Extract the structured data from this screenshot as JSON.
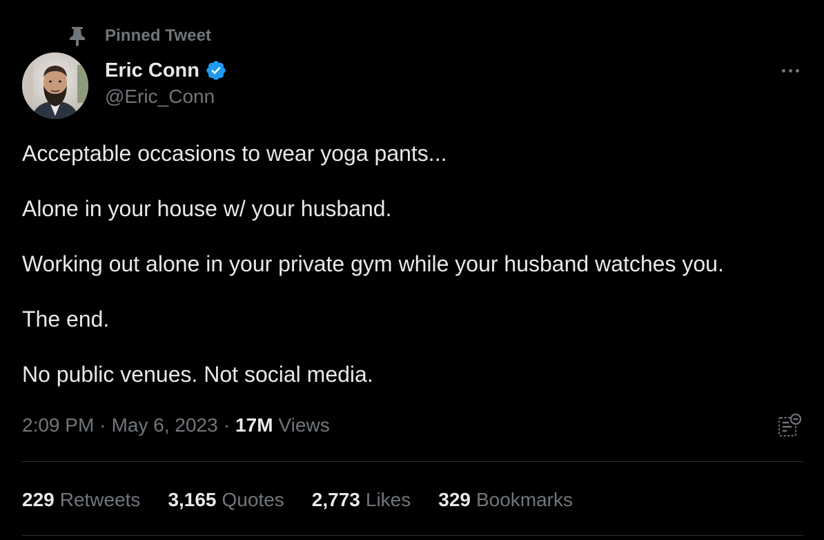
{
  "pinned": {
    "icon": "pin-icon",
    "label": "Pinned Tweet"
  },
  "author": {
    "avatar": "avatar",
    "name": "Eric Conn",
    "verified_icon": "verified-badge-icon",
    "verified_color": "#1d9bf0",
    "handle": "@Eric_Conn"
  },
  "more_icon": "more-options-icon",
  "tweet": {
    "lines": [
      "Acceptable occasions to wear yoga pants...",
      "Alone in your house w/ your husband.",
      "Working out alone in your private gym while your husband watches you.",
      "The end.",
      "No public venues. Not social media."
    ]
  },
  "meta": {
    "time": "2:09 PM",
    "separator": "·",
    "date": "May 6, 2023",
    "views_count": "17M",
    "views_label": "Views",
    "analytics_icon": "analytics-icon"
  },
  "stats": [
    {
      "count": "229",
      "label": "Retweets"
    },
    {
      "count": "3,165",
      "label": "Quotes"
    },
    {
      "count": "2,773",
      "label": "Likes"
    },
    {
      "count": "329",
      "label": "Bookmarks"
    }
  ],
  "colors": {
    "background": "#000000",
    "primary_text": "#e7e9ea",
    "secondary_text": "#71767b",
    "divider": "#2f3336",
    "accent": "#1d9bf0"
  }
}
